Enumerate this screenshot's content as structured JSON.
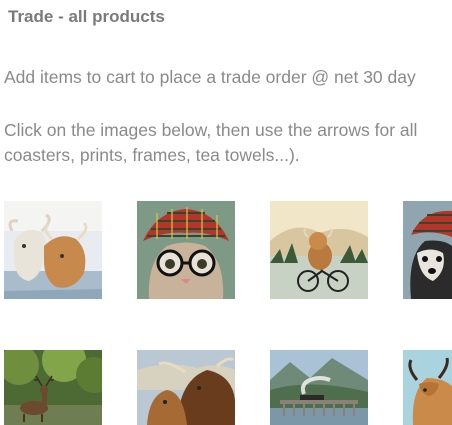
{
  "header": {
    "title": "Trade - all products"
  },
  "intro": {
    "line1": "Add items to cart to place a trade order @ net 30 day",
    "line2": "Click on the images below, then use the arrows for all",
    "line3": "coasters, prints, frames, tea towels...)."
  },
  "gallery": {
    "items": [
      {
        "subject": "highland-cows-in-water"
      },
      {
        "subject": "cat-with-tartan-hat-and-glasses"
      },
      {
        "subject": "highland-cow-on-bicycle"
      },
      {
        "subject": "dog-with-tartan-hat"
      },
      {
        "subject": "stag-in-forest"
      },
      {
        "subject": "highland-cow-and-calf"
      },
      {
        "subject": "steam-train-on-viaduct"
      },
      {
        "subject": "highland-cow-blue-background"
      }
    ]
  },
  "colors": {
    "title": "#7a7a7a",
    "text": "#8a8a8a",
    "tartan_red": "#b8332a",
    "cow_ginger": "#c98a4a"
  }
}
